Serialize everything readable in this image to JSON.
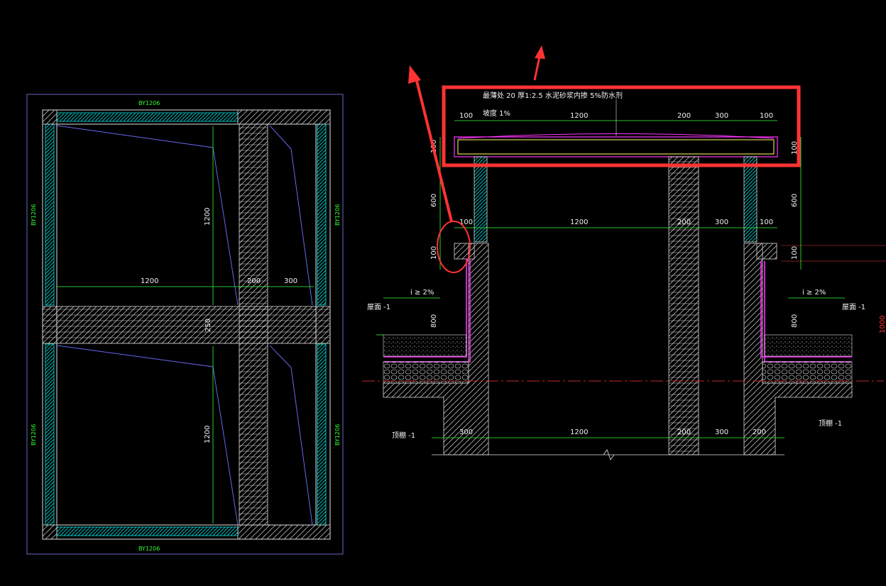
{
  "plan": {
    "label_top": "BY1206",
    "label_bottom": "BY1206",
    "label_left_upper": "BY1206",
    "label_left_lower": "BY1206",
    "label_right_upper": "BY1206",
    "label_right_lower": "BY1206",
    "dim_width": "1200",
    "dim_partition": "200",
    "dim_side": "300",
    "dim_height_upper": "1200",
    "dim_height_lower": "1200",
    "dim_middle": "250"
  },
  "section": {
    "note": "最薄处 20 厚1:2.5 水泥砂浆内掺 5%防水剂",
    "slope": "坡度 1%",
    "top_dims": [
      "100",
      "1200",
      "200",
      "300",
      "100"
    ],
    "mid_dims": [
      "100",
      "1200",
      "200",
      "300",
      "100"
    ],
    "bottom_dims": [
      "300",
      "1200",
      "200",
      "300",
      "200"
    ],
    "slab_left": "100",
    "slab_right": "100",
    "upstand_left": "600",
    "upstand_right": "600",
    "curb_left": "100",
    "curb_right": "100",
    "parapet_left": "800",
    "parapet_right": "800",
    "gradient_left": "i ≥ 2%",
    "gradient_right": "i ≥ 2%",
    "roof_left": "屋面 -1",
    "roof_right": "屋面 -1",
    "ceiling_left": "顶棚 -1",
    "ceiling_right": "顶棚 -1",
    "edge_mark": "1000"
  },
  "colors": {
    "background": "#000000",
    "dims": "#33ff33",
    "outline": "#f0f0f0",
    "wall_hatch": "#ffffff",
    "membrane": "#ff33ff",
    "highlight": "#ff3333",
    "slab": "#ffff66",
    "cyan": "#00e5e5",
    "blue_frame": "#6666cc"
  }
}
